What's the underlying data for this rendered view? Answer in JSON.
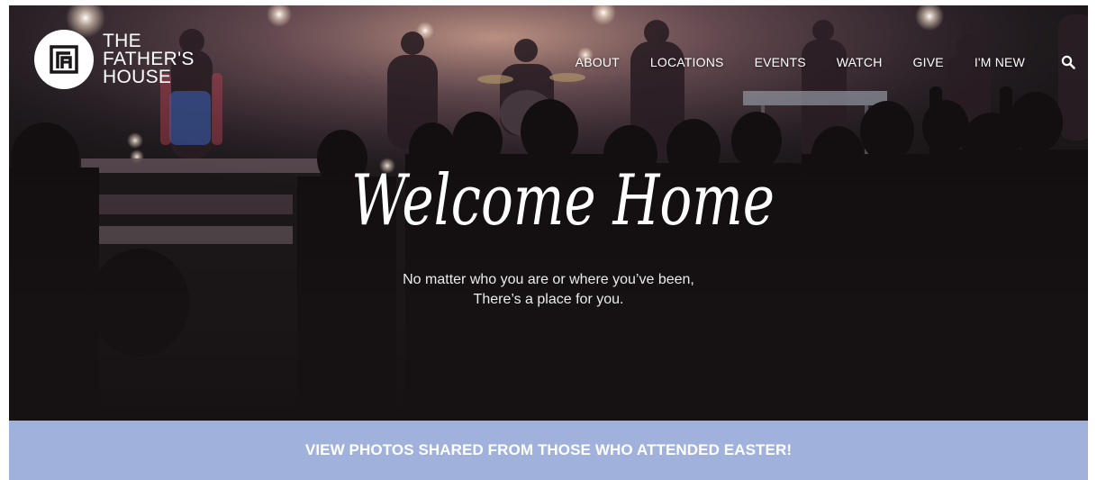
{
  "site": {
    "logo_line1": "THE",
    "logo_line2": "FATHER'S",
    "logo_line3": "HOUSE"
  },
  "nav": {
    "items": [
      {
        "label": "ABOUT"
      },
      {
        "label": "LOCATIONS"
      },
      {
        "label": "EVENTS"
      },
      {
        "label": "WATCH"
      },
      {
        "label": "GIVE"
      },
      {
        "label": "I'M NEW"
      }
    ],
    "search_icon": "search-icon"
  },
  "hero": {
    "headline": "Welcome Home",
    "subtitle_line1": "No matter who you are or where you’ve been,",
    "subtitle_line2": "There’s a place for you."
  },
  "banner": {
    "label": "VIEW PHOTOS SHARED FROM THOSE WHO ATTENDED EASTER!",
    "color": "#a0b2db"
  },
  "colors": {
    "hero_dark": "#1b1719",
    "stage_light": "#d9a37c",
    "text_white": "#ffffff"
  }
}
